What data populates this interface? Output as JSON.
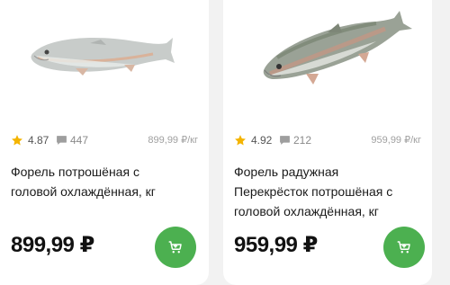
{
  "products": [
    {
      "rating": "4.87",
      "reviews": "447",
      "unit_price": "899,99 ₽/кг",
      "title_lines": [
        "Форель потрошёная с",
        "головой охлаждённая, кг"
      ],
      "price": "899,99 ₽",
      "image_icon": "trout-fish-image"
    },
    {
      "rating": "4.92",
      "reviews": "212",
      "unit_price": "959,99 ₽/кг",
      "title_lines": [
        "Форель радужная",
        "Перекрёсток потрошёная с",
        "головой охлаждённая, кг"
      ],
      "price": "959,99 ₽",
      "image_icon": "rainbow-trout-fish-image"
    }
  ],
  "icons": {
    "rating": "star-icon",
    "reviews": "comment-icon",
    "add_to_cart": "cart-icon"
  },
  "colors": {
    "accent": "#4cb050",
    "star": "#f4b400",
    "card_bg": "#ffffff",
    "page_bg": "#f2f2f2"
  }
}
